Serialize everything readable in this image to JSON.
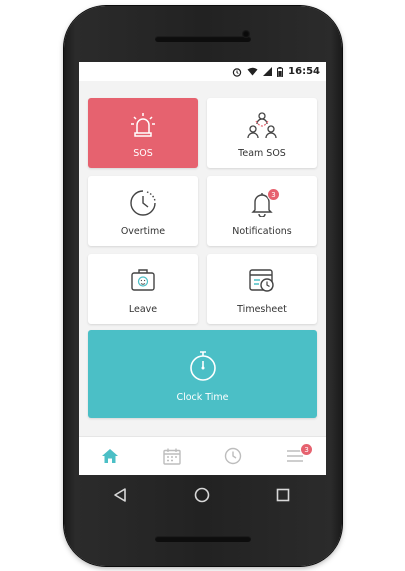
{
  "status_bar": {
    "time": "16:54"
  },
  "tiles": {
    "sos": {
      "label": "SOS"
    },
    "team_sos": {
      "label": "Team SOS"
    },
    "overtime": {
      "label": "Overtime"
    },
    "notifications": {
      "label": "Notifications",
      "badge": "3"
    },
    "leave": {
      "label": "Leave"
    },
    "timesheet": {
      "label": "Timesheet"
    },
    "clock_time": {
      "label": "Clock Time"
    }
  },
  "bottom_nav": {
    "items": [
      {
        "icon": "home-icon",
        "active": true
      },
      {
        "icon": "calendar-icon",
        "active": false
      },
      {
        "icon": "clock-icon",
        "active": false
      },
      {
        "icon": "menu-icon",
        "active": false,
        "badge": "3"
      }
    ]
  },
  "colors": {
    "sos": "#e6626f",
    "clock": "#4bbfc6",
    "active_nav": "#4bbfc6",
    "inactive_nav": "#bdbdbd"
  }
}
